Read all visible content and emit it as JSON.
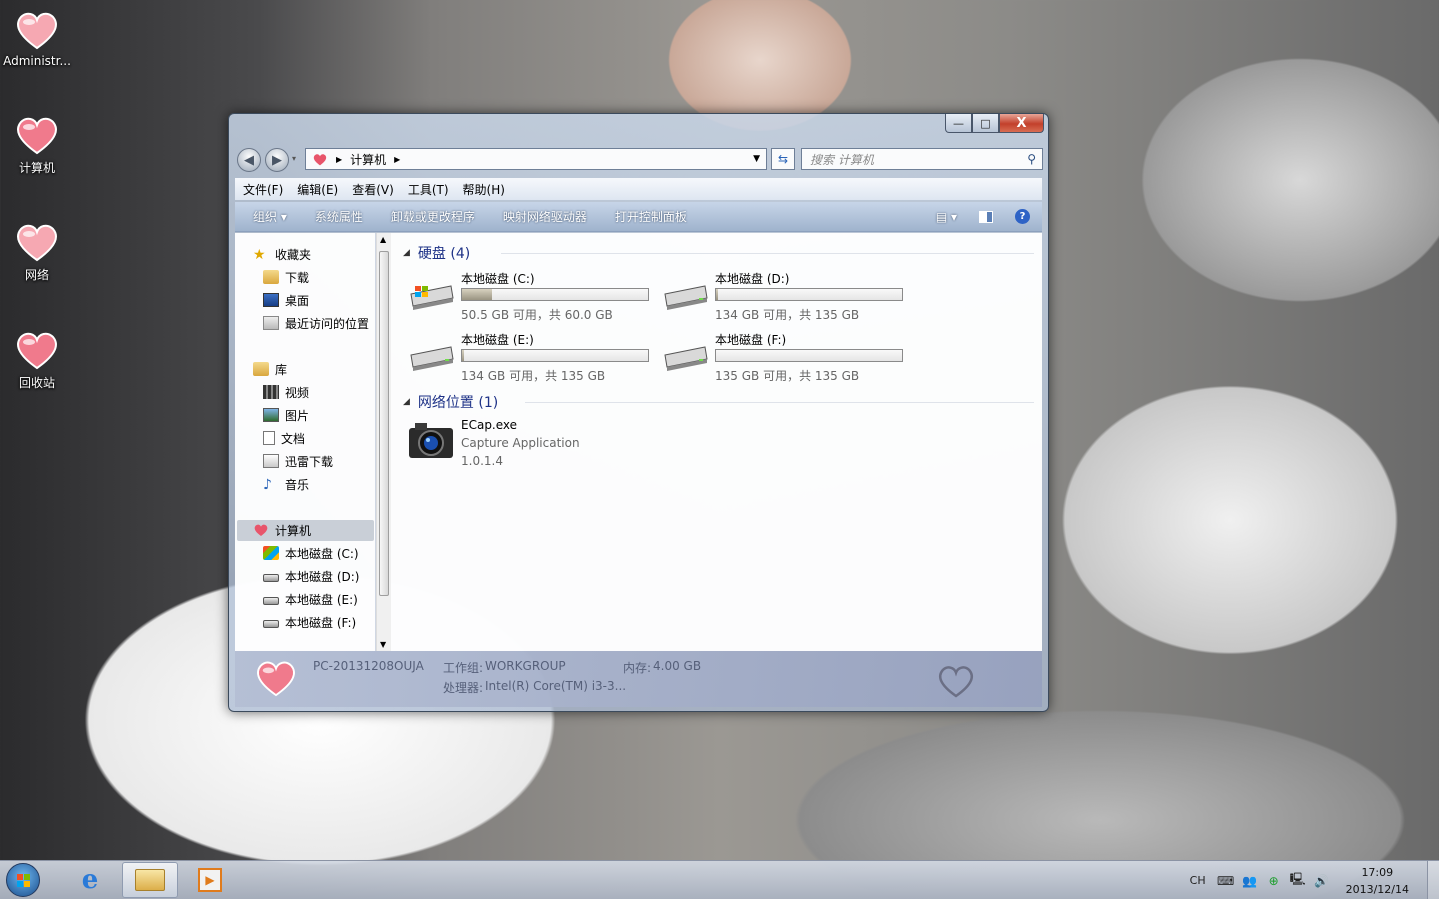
{
  "desktop": {
    "icons": [
      {
        "label": "Administr..."
      },
      {
        "label": "计算机"
      },
      {
        "label": "网络"
      },
      {
        "label": "回收站"
      }
    ]
  },
  "window": {
    "controls": {
      "minimize": "—",
      "maximize": "□",
      "close": "X"
    },
    "address": {
      "root_icon": "heart-icon",
      "crumb": "计算机"
    },
    "search": {
      "placeholder": "搜索 计算机"
    },
    "menu": [
      "文件(F)",
      "编辑(E)",
      "查看(V)",
      "工具(T)",
      "帮助(H)"
    ],
    "toolbar": {
      "organize": "组织 ▾",
      "items": [
        "系统属性",
        "卸载或更改程序",
        "映射网络驱动器",
        "打开控制面板"
      ]
    },
    "nav": {
      "favorites": "收藏夹",
      "favorites_items": [
        "下载",
        "桌面",
        "最近访问的位置"
      ],
      "library": "库",
      "library_items": [
        "视频",
        "图片",
        "文档",
        "迅雷下载",
        "音乐"
      ],
      "computer": "计算机",
      "computer_items": [
        "本地磁盘 (C:)",
        "本地磁盘 (D:)",
        "本地磁盘 (E:)",
        "本地磁盘 (F:)"
      ]
    },
    "content": {
      "group_disks": "硬盘 (4)",
      "drives": [
        {
          "name": "本地磁盘 (C:)",
          "info": "50.5 GB 可用，共 60.0 GB",
          "used_fraction": 0.16
        },
        {
          "name": "本地磁盘 (D:)",
          "info": "134 GB 可用，共 135 GB",
          "used_fraction": 0.01
        },
        {
          "name": "本地磁盘 (E:)",
          "info": "134 GB 可用，共 135 GB",
          "used_fraction": 0.01
        },
        {
          "name": "本地磁盘 (F:)",
          "info": "135 GB 可用，共 135 GB",
          "used_fraction": 0.0
        }
      ],
      "group_network": "网络位置 (1)",
      "network_item": {
        "name": "ECap.exe",
        "desc": "Capture Application",
        "version": "1.0.1.4"
      }
    },
    "details": {
      "pc": "PC-20131208OUJA",
      "workgroup_label": "工作组:",
      "workgroup": "WORKGROUP",
      "memory_label": "内存:",
      "memory": "4.00 GB",
      "processor_label": "处理器:",
      "processor": "Intel(R) Core(TM) i3-3..."
    }
  },
  "taskbar": {
    "lang": "CH",
    "time": "17:09",
    "date": "2013/12/14"
  },
  "colors": {
    "accent": "#1e3287",
    "heart": "#f07a8c"
  }
}
